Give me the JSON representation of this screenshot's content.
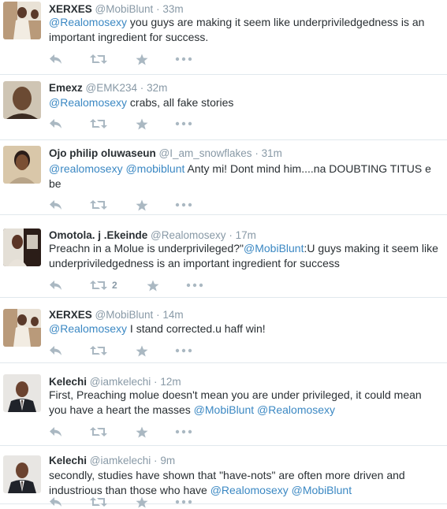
{
  "tweets": [
    {
      "name": "XERXES",
      "handle": "@MobiBlunt",
      "time": "33m",
      "segments": [
        {
          "text": "@Realomosexy",
          "mention": true
        },
        {
          "text": " you guys are making it seem like underpriviledgedness is an important ingredient for success.",
          "mention": false
        }
      ],
      "avatar": "xerxes",
      "retweet_count": ""
    },
    {
      "name": "Emexz",
      "handle": "@EMK234",
      "time": "32m",
      "segments": [
        {
          "text": "@Realomosexy",
          "mention": true
        },
        {
          "text": " crabs, all fake stories",
          "mention": false
        }
      ],
      "avatar": "emexz",
      "retweet_count": ""
    },
    {
      "name": "Ojo philip oluwaseun",
      "handle": "@I_am_snowflakes",
      "time": "31m",
      "segments": [
        {
          "text": "@realomosexy",
          "mention": true
        },
        {
          "text": " ",
          "mention": false
        },
        {
          "text": "@mobiblunt",
          "mention": true
        },
        {
          "text": " Anty mi! Dont mind him....na DOUBTING TITUS e be",
          "mention": false
        }
      ],
      "avatar": "ojo",
      "retweet_count": ""
    },
    {
      "name": "Omotola. j .Ekeinde",
      "handle": "@Realomosexy",
      "time": "17m",
      "segments": [
        {
          "text": "Preachn in a Molue is underprivileged?\"",
          "mention": false
        },
        {
          "text": "@MobiBlunt",
          "mention": true
        },
        {
          "text": ":U guys making it seem like underpriviledgedness is an important ingredient for success",
          "mention": false
        }
      ],
      "avatar": "omotola",
      "retweet_count": "2"
    },
    {
      "name": "XERXES",
      "handle": "@MobiBlunt",
      "time": "14m",
      "segments": [
        {
          "text": "@Realomosexy",
          "mention": true
        },
        {
          "text": " I stand corrected.u haff win!",
          "mention": false
        }
      ],
      "avatar": "xerxes",
      "retweet_count": ""
    },
    {
      "name": "Kelechi",
      "handle": "@iamkelechi",
      "time": "12m",
      "segments": [
        {
          "text": "First, Preaching molue doesn't mean you are under privileged, it could mean you have a heart the masses  ",
          "mention": false
        },
        {
          "text": "@MobiBlunt",
          "mention": true
        },
        {
          "text": " ",
          "mention": false
        },
        {
          "text": "@Realomosexy",
          "mention": true
        }
      ],
      "avatar": "kelechi",
      "retweet_count": ""
    },
    {
      "name": "Kelechi",
      "handle": "@iamkelechi",
      "time": "9m",
      "segments": [
        {
          "text": "secondly, studies have shown that \"have-nots\"  are often more driven and industrious than those who have    ",
          "mention": false
        },
        {
          "text": "@Realomosexy",
          "mention": true
        },
        {
          "text": " ",
          "mention": false
        },
        {
          "text": "@MobiBlunt",
          "mention": true
        }
      ],
      "avatar": "kelechi",
      "retweet_count": ""
    }
  ],
  "separator": "·",
  "icons": {
    "reply": "reply-icon",
    "retweet": "retweet-icon",
    "favorite": "favorite-star-icon",
    "more": "more-dots-icon"
  },
  "colors": {
    "mention": "#3b88c3",
    "meta": "#8899a6",
    "action": "#aab8c2",
    "text": "#292f33"
  }
}
